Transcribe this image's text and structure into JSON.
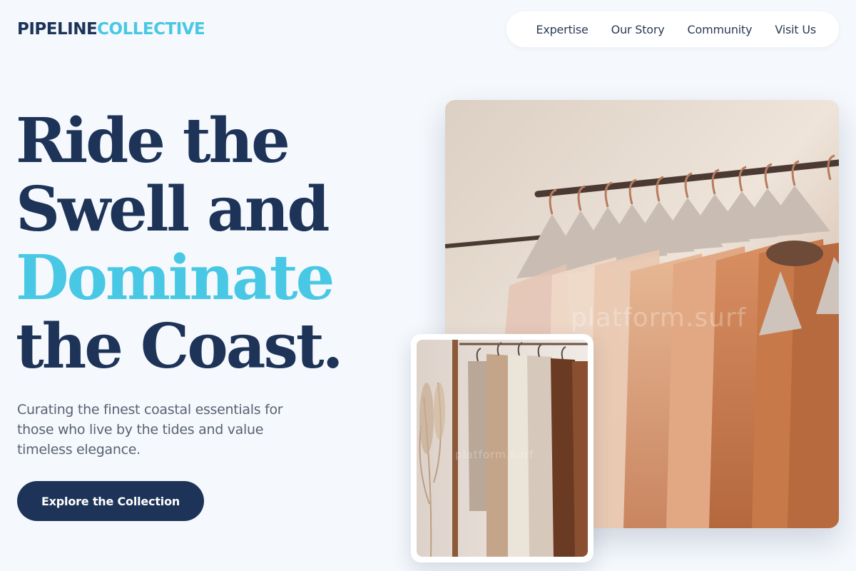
{
  "brand": {
    "name_part1": "PIPELINE",
    "name_part2": "COLLECTIVE",
    "colors": {
      "primary": "#1d3358",
      "accent": "#48c8e4"
    }
  },
  "nav": {
    "items": [
      "Expertise",
      "Our Story",
      "Community",
      "Visit Us"
    ]
  },
  "hero": {
    "headline": {
      "line1": "Ride the",
      "line2": "Swell and",
      "line3_accent": "Dominate",
      "line4": "the Coast."
    },
    "subtitle": "Curating the finest coastal essentials for those who live by the tides and value timeless elegance.",
    "cta_label": "Explore the Collection"
  },
  "images": {
    "main": {
      "subject": "clothing-rack-dresses-photo",
      "watermark": "platform.surf"
    },
    "secondary": {
      "subject": "hanging-knitwear-photo",
      "watermark": "platform.surf"
    }
  }
}
